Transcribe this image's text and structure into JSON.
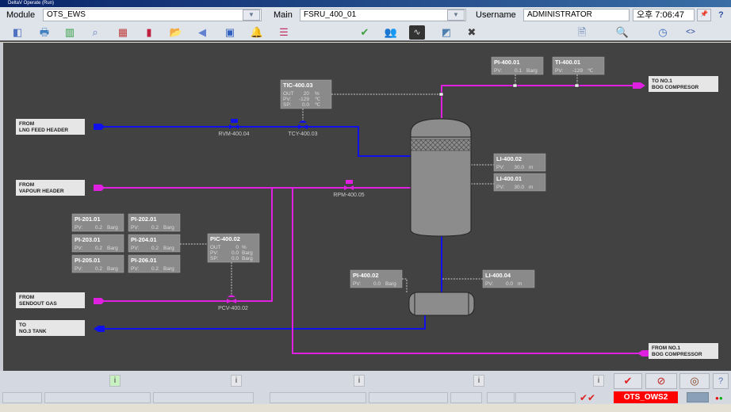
{
  "window": {
    "title": "DeltaV Operate (Run)"
  },
  "header": {
    "module_label": "Module",
    "module_value": "OTS_EWS",
    "main_label": "Main",
    "main_value": "FSRU_400_01",
    "username_label": "Username",
    "username_value": "ADMINISTRATOR",
    "clock": "오후 7:06:47",
    "help": "?"
  },
  "toolbar": {
    "icons": [
      "exit-icon",
      "print-icon",
      "faceplate-icon",
      "search-icon",
      "layout-icon",
      "display-icon",
      "open-folder-icon",
      "back-icon",
      "screen-icon",
      "alarm-bell-icon",
      "alarm-list-icon",
      "acknowledge-icon",
      "users-icon",
      "trend-icon",
      "diagnostics-icon",
      "tools-icon",
      "document-icon",
      "lookup-icon",
      "clock-icon",
      "swap-icon"
    ]
  },
  "colors": {
    "vapour": "#e020e0",
    "liquid": "#1010e8",
    "background": "#424242",
    "station_alarm": "#ff0000"
  },
  "diagram": {
    "streams": {
      "lng_feed": [
        "FROM",
        "LNG FEED HEADER"
      ],
      "vapour": [
        "FROM",
        "VAPOUR HEADER"
      ],
      "sendout": [
        "FROM",
        "SENDOUT GAS"
      ],
      "tank": [
        "TO",
        "NO.3 TANK"
      ],
      "bog_out": [
        "TO NO.1",
        "BOG COMPRESOR"
      ],
      "bog_in": [
        "FROM NO.1",
        "BOG COMPRESSOR"
      ]
    },
    "valves": {
      "rvm": "RVM-400.04",
      "tcy": "TCY-400.03",
      "rpm": "RPM-400.05",
      "pcv": "PCV-400.02"
    },
    "tic": {
      "tag": "TIC-400.03",
      "rows": [
        [
          "OUT",
          "20",
          "%"
        ],
        [
          "PV:",
          "-129",
          "℃"
        ],
        [
          "SP:",
          "0.0",
          "℃"
        ]
      ]
    },
    "pic": {
      "tag": "PIC-400.02",
      "rows": [
        [
          "OUT",
          "0",
          "%"
        ],
        [
          "PV:",
          "0.0",
          "Barg"
        ],
        [
          "SP:",
          "0.0",
          "Barg"
        ]
      ]
    },
    "indicators": [
      {
        "tag": "PI-400.01",
        "pv": "0.1",
        "unit": "Barg"
      },
      {
        "tag": "TI-400.01",
        "pv": "-129",
        "unit": "℃"
      },
      {
        "tag": "LI-400.02",
        "pv": "30.0",
        "unit": "m"
      },
      {
        "tag": "LI-400.01",
        "pv": "30.0",
        "unit": "m"
      },
      {
        "tag": "PI-201.01",
        "pv": "0.2",
        "unit": "Barg"
      },
      {
        "tag": "PI-202.01",
        "pv": "0.2",
        "unit": "Barg"
      },
      {
        "tag": "PI-203.01",
        "pv": "0.2",
        "unit": "Barg"
      },
      {
        "tag": "PI-204.01",
        "pv": "0.2",
        "unit": "Barg"
      },
      {
        "tag": "PI-205.01",
        "pv": "0.2",
        "unit": "Barg"
      },
      {
        "tag": "PI-206.01",
        "pv": "0.2",
        "unit": "Barg"
      },
      {
        "tag": "PI-400.02",
        "pv": "0.0",
        "unit": "Barg"
      },
      {
        "tag": "LI-400.04",
        "pv": "0.0",
        "unit": "m"
      }
    ],
    "pv_label": "PV:"
  },
  "statusbar": {
    "info": "i",
    "station": "OTS_OWS2",
    "help": "?"
  }
}
